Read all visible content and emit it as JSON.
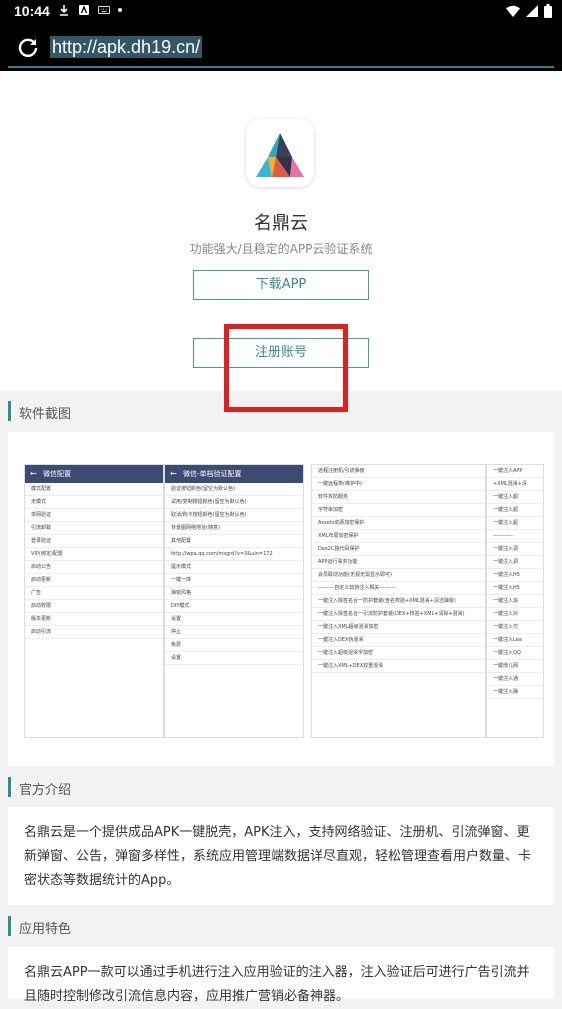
{
  "status_bar": {
    "time": "10:44"
  },
  "browser": {
    "url": "http://apk.dh19.cn/"
  },
  "hero": {
    "app_name": "名鼎云",
    "tagline": "功能强大/且稳定的APP云验证系统",
    "download_label": "下载APP",
    "register_label": "注册账号"
  },
  "screenshots_section": {
    "title": "软件截图",
    "shot1": {
      "title": "微信配置",
      "items": [
        "模式配置",
        "无模式",
        "单网验证",
        "引流卸载",
        "登录验证",
        "VIP(绑定)配置",
        "启动公告",
        "启动更新",
        "广告",
        "启动权限",
        "版本更新",
        "启动引流"
      ]
    },
    "shot2": {
      "title": "微信-单档验证配置",
      "fields": [
        "验证按钮颜色(留空为默认色)",
        "试用/复制按钮颜色(留空为默认色)",
        "取消/购卡按钮颜色(留空为默认色)",
        "背景图网络地址(随意)",
        "其他配置",
        "http://wpa.qq.com/msgrd?v=3&uin=172",
        "提示模式",
        "一键一体",
        "弹窗风格",
        "DIY模式",
        "设置",
        "停止",
        "免费",
        "设置"
      ]
    },
    "shot3": {
      "items": [
        "远程注册机/引流弹窗",
        "一键远程类(维护中)",
        "软件攻防服务",
        "字符串加密",
        "Assets资源加密保护",
        "XML布局加密保护",
        "Dex2C独代码保护",
        "APP运行事务功能",
        "会员联动功能(无视无需显示即可)",
        "---------自定义劫持注入相关---------",
        "一键注入除签名合一防护套装(含名校验+XML混淆+清洁弹窗)",
        "一键注入除签名合一引流防护套装(DEX+校验+XML+清除+混淆)",
        "一键注入XML超级混淆加密",
        "一键注入DEX伪混淆",
        "一键注入超级混淆字加密",
        "一键注入XML+DEX双重混淆"
      ]
    },
    "shot4": {
      "items": [
        "一键注入APP",
        "+XML混淆+清",
        "一键注入超",
        "一键注入超",
        "一键注入超",
        "-----------",
        "一键注入调",
        "一键注入调",
        "一键注入H5",
        "一键注入H5",
        "一键注入追",
        "一键注入对",
        "一键注入付",
        "一键注入Lea",
        "一键注入QQ",
        "一键增儿网",
        "一键注入通",
        "一键注入弹"
      ]
    }
  },
  "intro_section": {
    "title": "官方介绍",
    "text": "名鼎云是一个提供成品APK一键脱壳，APK注入，支持网络验证、注册机、引流弹窗、更新弹窗、公告，弹窗多样性，系统应用管理端数据详尽直观，轻松管理查看用户数量、卡密状态等数据统计的App。"
  },
  "features_section": {
    "title": "应用特色",
    "text": "名鼎云APP一款可以通过手机进行注入应用验证的注入器，注入验证后可进行广告引流并且随时控制修改引流信息内容，应用推广营销必备神器。"
  },
  "colors": {
    "accent": "#2e8f8f",
    "highlight": "#e0201c"
  }
}
